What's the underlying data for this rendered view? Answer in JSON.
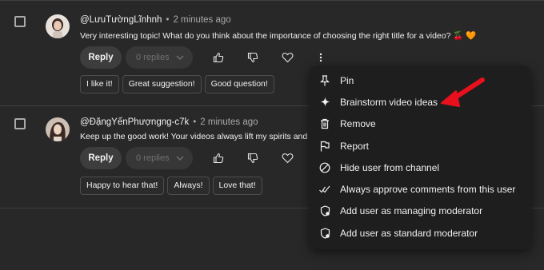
{
  "comments": [
    {
      "handle": "@LưuTườngLĩnhnh",
      "time": "2 minutes ago",
      "text": "Very interesting topic! What do you think about the importance of choosing the right title for a video? 🍒 🧡",
      "reply_label": "Reply",
      "replies_label": "0 replies",
      "chips": [
        "I like it!",
        "Great suggestion!",
        "Good question!"
      ]
    },
    {
      "handle": "@ĐặngYếnPhượngng-c7k",
      "time": "2 minutes ago",
      "text": "Keep up the good work! Your videos always lift my spirits and add",
      "reply_label": "Reply",
      "replies_label": "0 replies",
      "chips": [
        "Happy to hear that!",
        "Always!",
        "Love that!"
      ]
    }
  ],
  "menu": {
    "items": [
      {
        "label": "Pin",
        "icon": "pin-icon"
      },
      {
        "label": "Brainstorm video ideas",
        "icon": "sparkle-icon"
      },
      {
        "label": "Remove",
        "icon": "trash-icon"
      },
      {
        "label": "Report",
        "icon": "flag-icon"
      },
      {
        "label": "Hide user from channel",
        "icon": "block-icon"
      },
      {
        "label": "Always approve comments from this user",
        "icon": "double-check-icon"
      },
      {
        "label": "Add user as managing moderator",
        "icon": "shield-icon"
      },
      {
        "label": "Add user as standard moderator",
        "icon": "shield-icon"
      }
    ]
  },
  "colors": {
    "background": "#282828",
    "menu_background": "#1e1e1e",
    "annotation_arrow": "#e8101c"
  }
}
